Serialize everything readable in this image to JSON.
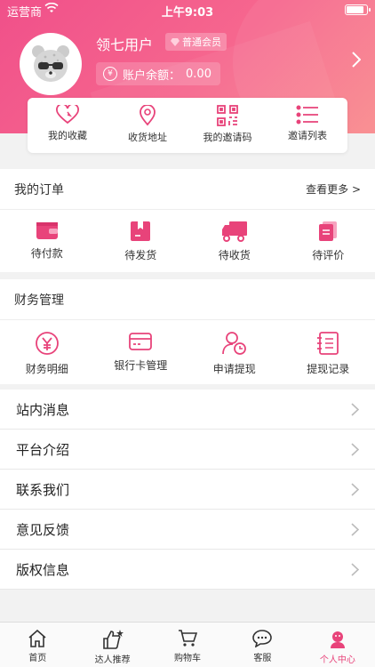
{
  "status_bar": {
    "carrier": "运营商",
    "time": "上午9:03"
  },
  "profile": {
    "username": "领七用户",
    "member_level": "普通会员",
    "balance_label": "账户余额：",
    "balance_value": "0.00"
  },
  "quick_actions": [
    {
      "label": "我的收藏",
      "icon": "heart-icon"
    },
    {
      "label": "收货地址",
      "icon": "location-pin-icon"
    },
    {
      "label": "我的邀请码",
      "icon": "qr-code-icon"
    },
    {
      "label": "邀请列表",
      "icon": "list-icon"
    }
  ],
  "orders": {
    "title": "我的订单",
    "more": "查看更多 >",
    "items": [
      {
        "label": "待付款",
        "icon": "wallet-icon"
      },
      {
        "label": "待发货",
        "icon": "package-icon"
      },
      {
        "label": "待收货",
        "icon": "truck-icon"
      },
      {
        "label": "待评价",
        "icon": "review-icon"
      }
    ]
  },
  "finance": {
    "title": "财务管理",
    "items": [
      {
        "label": "财务明细",
        "icon": "yen-coin-icon"
      },
      {
        "label": "银行卡管理",
        "icon": "bank-card-icon"
      },
      {
        "label": "申请提现",
        "icon": "user-clock-icon"
      },
      {
        "label": "提现记录",
        "icon": "record-book-icon"
      }
    ]
  },
  "menu": [
    {
      "label": "站内消息"
    },
    {
      "label": "平台介绍"
    },
    {
      "label": "联系我们"
    },
    {
      "label": "意见反馈"
    },
    {
      "label": "版权信息"
    }
  ],
  "tabs": [
    {
      "label": "首页",
      "icon": "home-icon"
    },
    {
      "label": "达人推荐",
      "icon": "thumbs-up-icon"
    },
    {
      "label": "购物车",
      "icon": "cart-icon"
    },
    {
      "label": "客服",
      "icon": "chat-icon"
    },
    {
      "label": "个人中心",
      "icon": "profile-icon"
    }
  ],
  "colors": {
    "accent": "#e8437a",
    "header_start": "#f0508a",
    "header_end": "#f98a8d"
  }
}
